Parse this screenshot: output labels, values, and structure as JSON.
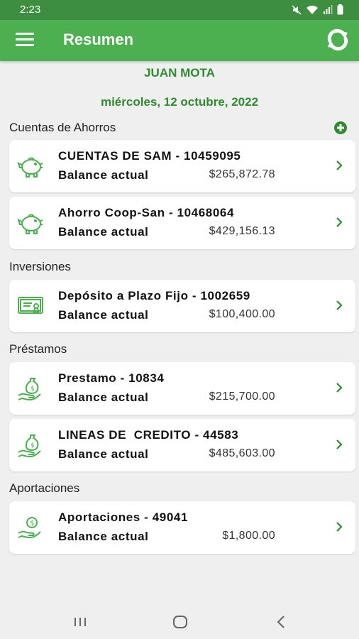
{
  "status": {
    "time": "2:23"
  },
  "appbar": {
    "title": "Resumen",
    "menu_icon": "hamburger-menu-icon",
    "refresh_icon": "refresh-icon"
  },
  "user_name": "JUAN MOTA",
  "date": "miércoles, 12 octubre, 2022",
  "colors": {
    "primary": "#4caf50",
    "statusbar": "#3e8e41",
    "accent_text": "#2e8b2e",
    "background": "#efefef"
  },
  "sections": {
    "ahorros": {
      "title": "Cuentas de Ahorros",
      "accounts": [
        {
          "name": "CUENTAS DE SAM - 10459095",
          "label": "Balance actual",
          "amount": "$265,872.78",
          "icon": "piggy-bank-icon"
        },
        {
          "name": "Ahorro Coop-San - 10468064",
          "label": "Balance actual",
          "amount": "$429,156.13",
          "icon": "piggy-bank-icon"
        }
      ]
    },
    "inversiones": {
      "title": "Inversiones",
      "accounts": [
        {
          "name": "Depósito a Plazo Fijo - 1002659",
          "label": "Balance actual",
          "amount": "$100,400.00",
          "icon": "certificate-icon"
        }
      ]
    },
    "prestamos": {
      "title": "Préstamos",
      "accounts": [
        {
          "name": "Prestamo - 10834",
          "label": "Balance actual",
          "amount": "$215,700.00",
          "icon": "money-bag-hand-icon"
        },
        {
          "name": "LINEAS DE  CREDITO - 44583",
          "label": "Balance actual",
          "amount": "$485,603.00",
          "icon": "money-bag-hand-icon"
        }
      ]
    },
    "aportaciones": {
      "title": "Aportaciones",
      "accounts": [
        {
          "name": "Aportaciones - 49041",
          "label": "Balance actual",
          "amount": "$1,800.00",
          "icon": "coin-hand-icon"
        }
      ]
    }
  }
}
